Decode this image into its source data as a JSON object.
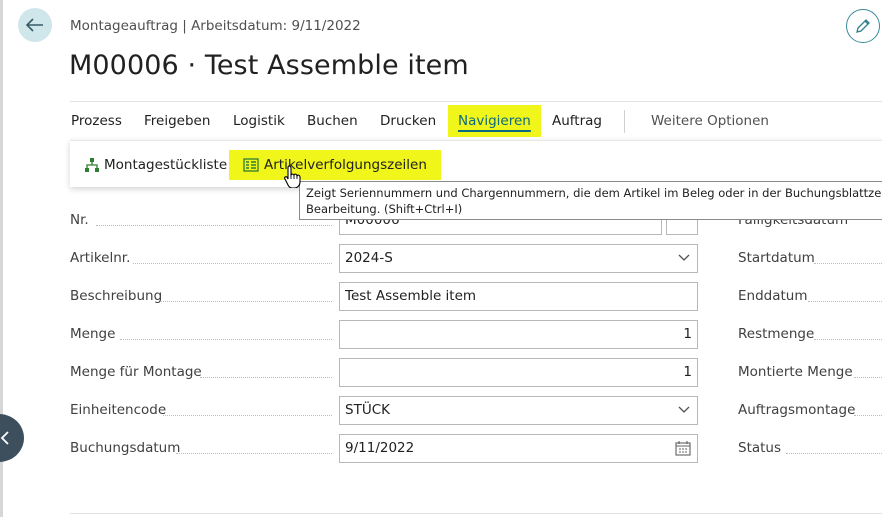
{
  "header": {
    "breadcrumb": "Montageauftrag | Arbeitsdatum: 9/11/2022",
    "title": "M00006 · Test Assemble item"
  },
  "tabs": [
    {
      "label": "Prozess"
    },
    {
      "label": "Freigeben"
    },
    {
      "label": "Logistik"
    },
    {
      "label": "Buchen"
    },
    {
      "label": "Drucken"
    },
    {
      "label": "Navigieren"
    },
    {
      "label": "Auftrag"
    },
    {
      "label": "Weitere Optionen"
    }
  ],
  "active_tab": "Navigieren",
  "navigate_menu": {
    "items": [
      {
        "label": "Montagestückliste",
        "icon": "hierarchy-icon"
      },
      {
        "label": "Artikelverfolgungszeilen",
        "icon": "tracking-lines-icon"
      }
    ]
  },
  "tooltip": {
    "line1": "Zeigt Seriennummern und Chargennummern, die dem Artikel im Beleg oder in der Buchungsblattzeile zugew",
    "line2": "Bearbeitung. (Shift+Ctrl+I)"
  },
  "form": {
    "left": [
      {
        "label": "Nr.",
        "value": "M00006"
      },
      {
        "label": "Artikelnr.",
        "value": "2024-S"
      },
      {
        "label": "Beschreibung",
        "value": "Test Assemble item"
      },
      {
        "label": "Menge",
        "value": "1"
      },
      {
        "label": "Menge für Montage",
        "value": "1"
      },
      {
        "label": "Einheitencode",
        "value": "STÜCK"
      },
      {
        "label": "Buchungsdatum",
        "value": "9/11/2022"
      }
    ],
    "right": [
      {
        "label": "Fälligkeitsdatum"
      },
      {
        "label": "Startdatum"
      },
      {
        "label": "Enddatum"
      },
      {
        "label": "Restmenge"
      },
      {
        "label": "Montierte Menge"
      },
      {
        "label": "Auftragsmontage"
      },
      {
        "label": "Status"
      }
    ]
  },
  "colors": {
    "highlight": "#f0f51a",
    "accent": "#0b6a80",
    "back_button_bg": "#cfe6ea",
    "icon_green": "#2e7d32"
  }
}
